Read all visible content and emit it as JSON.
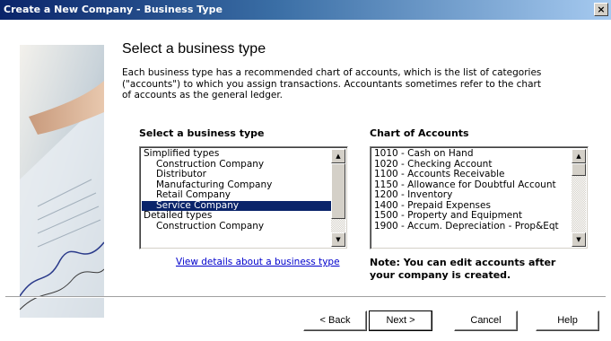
{
  "window": {
    "title": "Create a New Company - Business Type",
    "close_glyph": "×"
  },
  "main": {
    "heading": "Select a business type",
    "description": "Each business type has a recommended chart of accounts, which is the list of categories (\"accounts\") to which you assign transactions. Accountants sometimes refer to the chart of accounts as the general ledger."
  },
  "business_types": {
    "label": "Select a business type",
    "items": [
      {
        "label": "Simplified types",
        "indent": false,
        "selected": false
      },
      {
        "label": "Construction Company",
        "indent": true,
        "selected": false
      },
      {
        "label": "Distributor",
        "indent": true,
        "selected": false
      },
      {
        "label": "Manufacturing Company",
        "indent": true,
        "selected": false
      },
      {
        "label": "Retail Company",
        "indent": true,
        "selected": false
      },
      {
        "label": "Service Company",
        "indent": true,
        "selected": true
      },
      {
        "label": "Detailed types",
        "indent": false,
        "selected": false
      },
      {
        "label": "Construction Company",
        "indent": true,
        "selected": false
      }
    ],
    "link": "View details about a business type"
  },
  "chart_of_accounts": {
    "label": "Chart of Accounts",
    "items": [
      "1010 - Cash on Hand",
      "1020 - Checking Account",
      "1100 - Accounts Receivable",
      "1150 - Allowance for Doubtful Account",
      "1200 - Inventory",
      "1400 - Prepaid Expenses",
      "1500 - Property and Equipment",
      "1900 - Accum. Depreciation - Prop&Eqt"
    ],
    "note": "Note: You can edit accounts after your company is created."
  },
  "buttons": {
    "back": "< Back",
    "next": "Next >",
    "cancel": "Cancel",
    "help": "Help"
  }
}
